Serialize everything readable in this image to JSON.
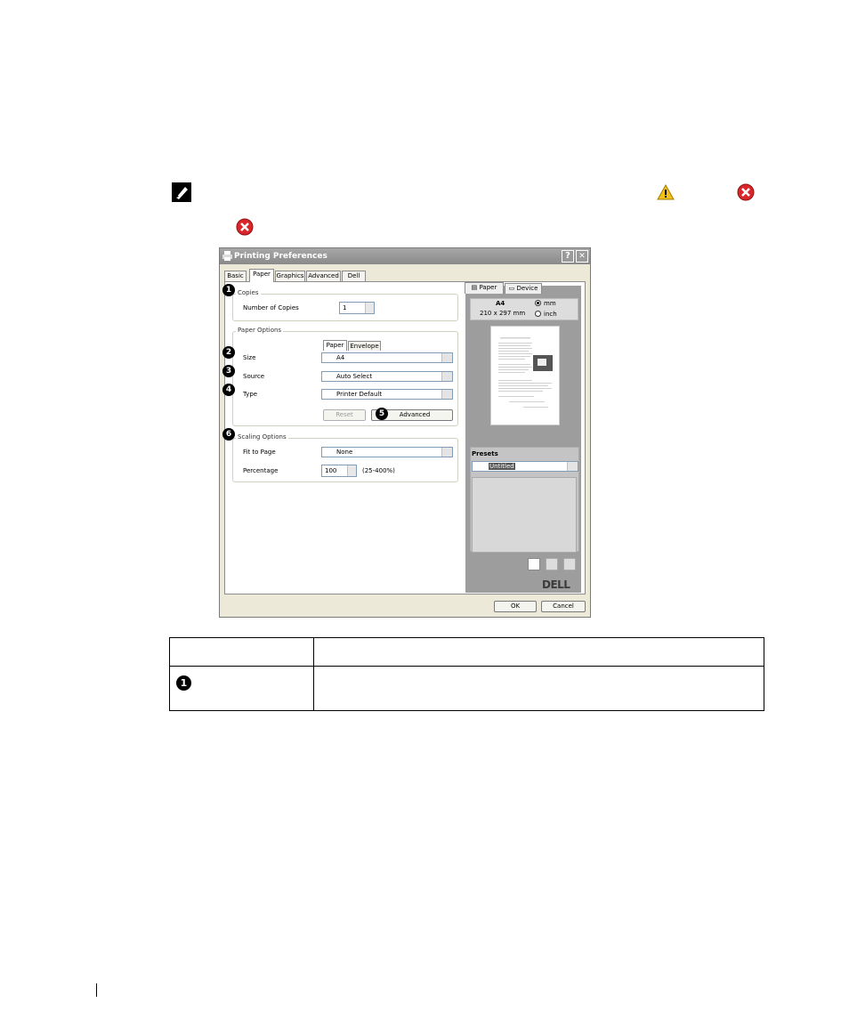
{
  "note": {
    "icon": "note-pencil-icon",
    "warning_icon": "warning-icon",
    "error_icon": "error-icon"
  },
  "dialog": {
    "title": "Printing Preferences",
    "help_label": "?",
    "close_label": "✕",
    "tabs": [
      {
        "label": "Basic"
      },
      {
        "label": "Paper"
      },
      {
        "label": "Graphics"
      },
      {
        "label": "Advanced"
      },
      {
        "label": "Dell"
      }
    ],
    "copies": {
      "group_label": "Copies",
      "number_label": "Number of Copies",
      "value": "1"
    },
    "paper_options": {
      "group_label": "Paper Options",
      "subtabs": [
        {
          "label": "Paper"
        },
        {
          "label": "Envelope"
        }
      ],
      "size_label": "Size",
      "size_value": "A4",
      "source_label": "Source",
      "source_value": "Auto Select",
      "type_label": "Type",
      "type_value": "Printer Default",
      "reset_label": "Reset",
      "advanced_label": "Advanced"
    },
    "scaling": {
      "group_label": "Scaling Options",
      "fit_label": "Fit to Page",
      "fit_value": "None",
      "percentage_label": "Percentage",
      "percentage_value": "100",
      "range_text": "(25-400%)"
    },
    "preview": {
      "tab_paper": "Paper",
      "tab_device": "Device",
      "paper_name": "A4",
      "paper_dims": "210 x 297 mm",
      "unit_mm": "mm",
      "unit_inch": "inch",
      "presets_label": "Presets",
      "presets_value": "Untitled",
      "brand": "DELL"
    },
    "ok_label": "OK",
    "cancel_label": "Cancel"
  },
  "callouts": [
    "1",
    "2",
    "3",
    "4",
    "5",
    "6"
  ],
  "table": {
    "rows": [
      {
        "col1": "",
        "col2": ""
      },
      {
        "col1_callout": "1",
        "col2": ""
      }
    ]
  },
  "colors": {
    "accent": "#000000",
    "error": "#d9262b",
    "warning": "#f3c01a",
    "panel_gray": "#9d9d9d"
  }
}
